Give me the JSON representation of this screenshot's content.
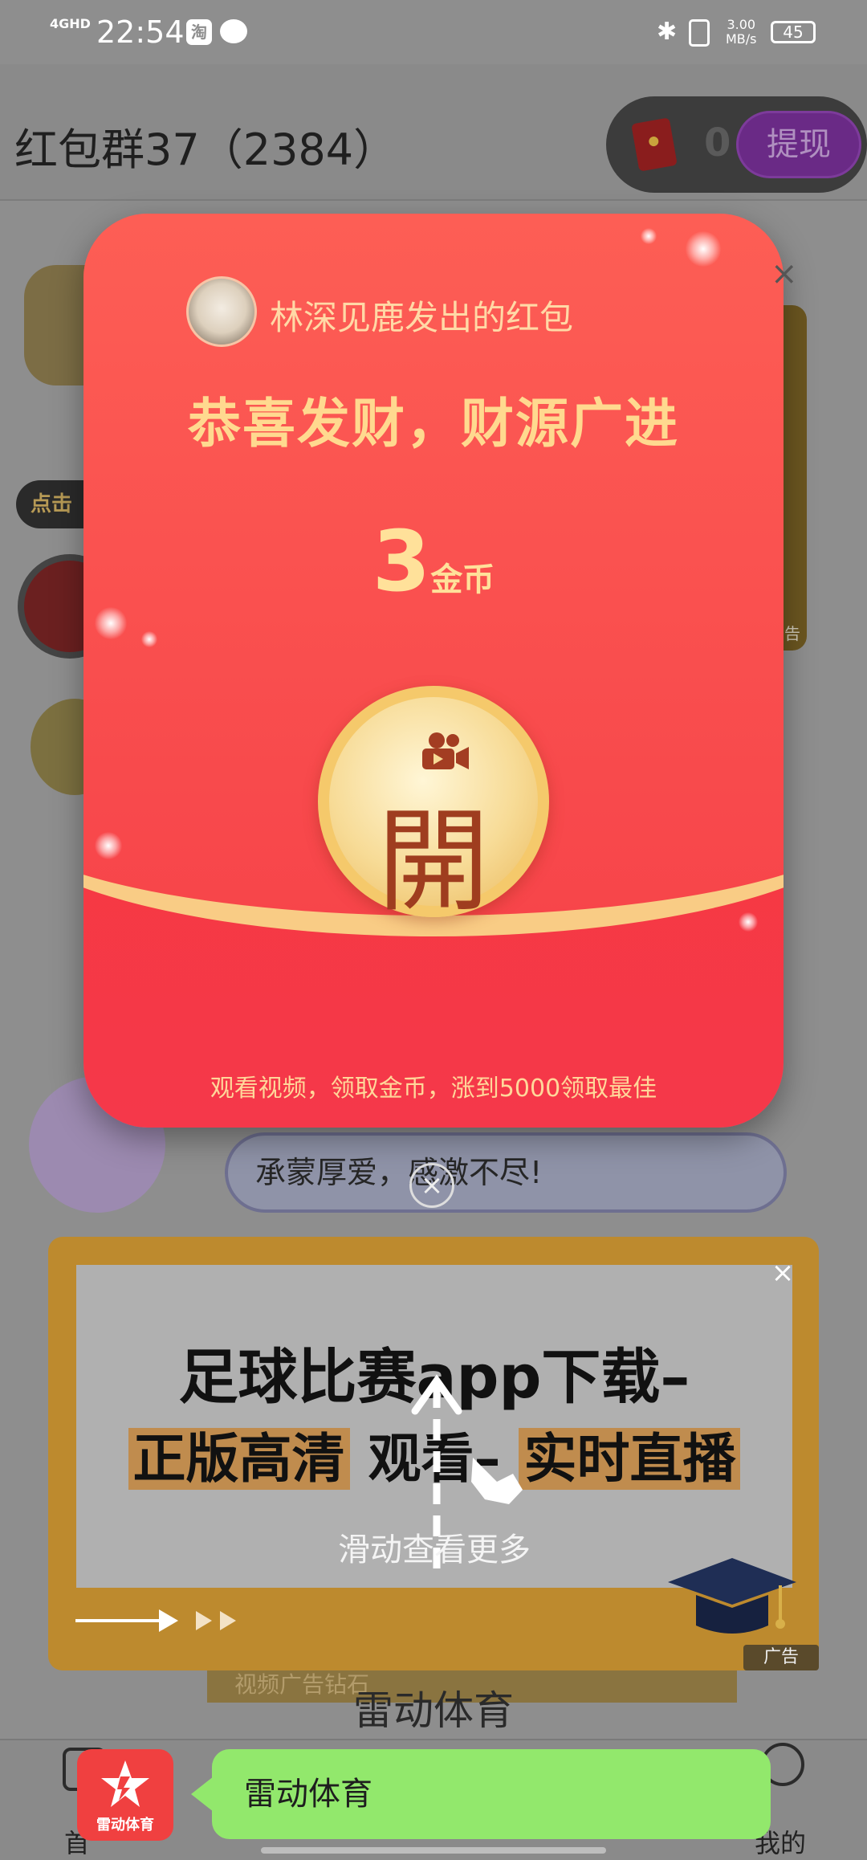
{
  "status_bar": {
    "network": "4GHD",
    "time": "22:54",
    "app_icon_1": "淘",
    "speed_value": "3.00",
    "speed_unit": "MB/s",
    "battery": "45"
  },
  "header": {
    "group_title": "红包群37（2384）",
    "coin_count": "0",
    "withdraw_label": "提现"
  },
  "chat": {
    "tap_tag": "点击",
    "message": "承蒙厚爱，感激不尽!",
    "ad_strip_label": "告"
  },
  "red_envelope": {
    "sender": "林深见鹿发出的红包",
    "greeting": "恭喜发财，财源广进",
    "amount": "3",
    "unit": "金币",
    "open_char": "開",
    "note": "观看视频，领取金币，涨到5000领取最佳",
    "close": "×"
  },
  "ad": {
    "line1": "足球比赛app下载–",
    "line2_a": "正版高清",
    "line2_b": "观看–",
    "line2_c": "实时直播",
    "swipe_hint": "滑动查看更多",
    "ad_label": "广告",
    "close": "×"
  },
  "bottom": {
    "app_name": "雷动体育",
    "strip_text": "视频广告钻石",
    "nav_home": "首",
    "nav_mine": "我的"
  },
  "toast": {
    "logo_label": "雷动体育",
    "text": "雷动体育"
  },
  "colors": {
    "envelope_red": "#f63a3c",
    "gold": "#f9cc85",
    "toast_green": "#92e86c",
    "ad_frame": "#bd8a2e"
  }
}
